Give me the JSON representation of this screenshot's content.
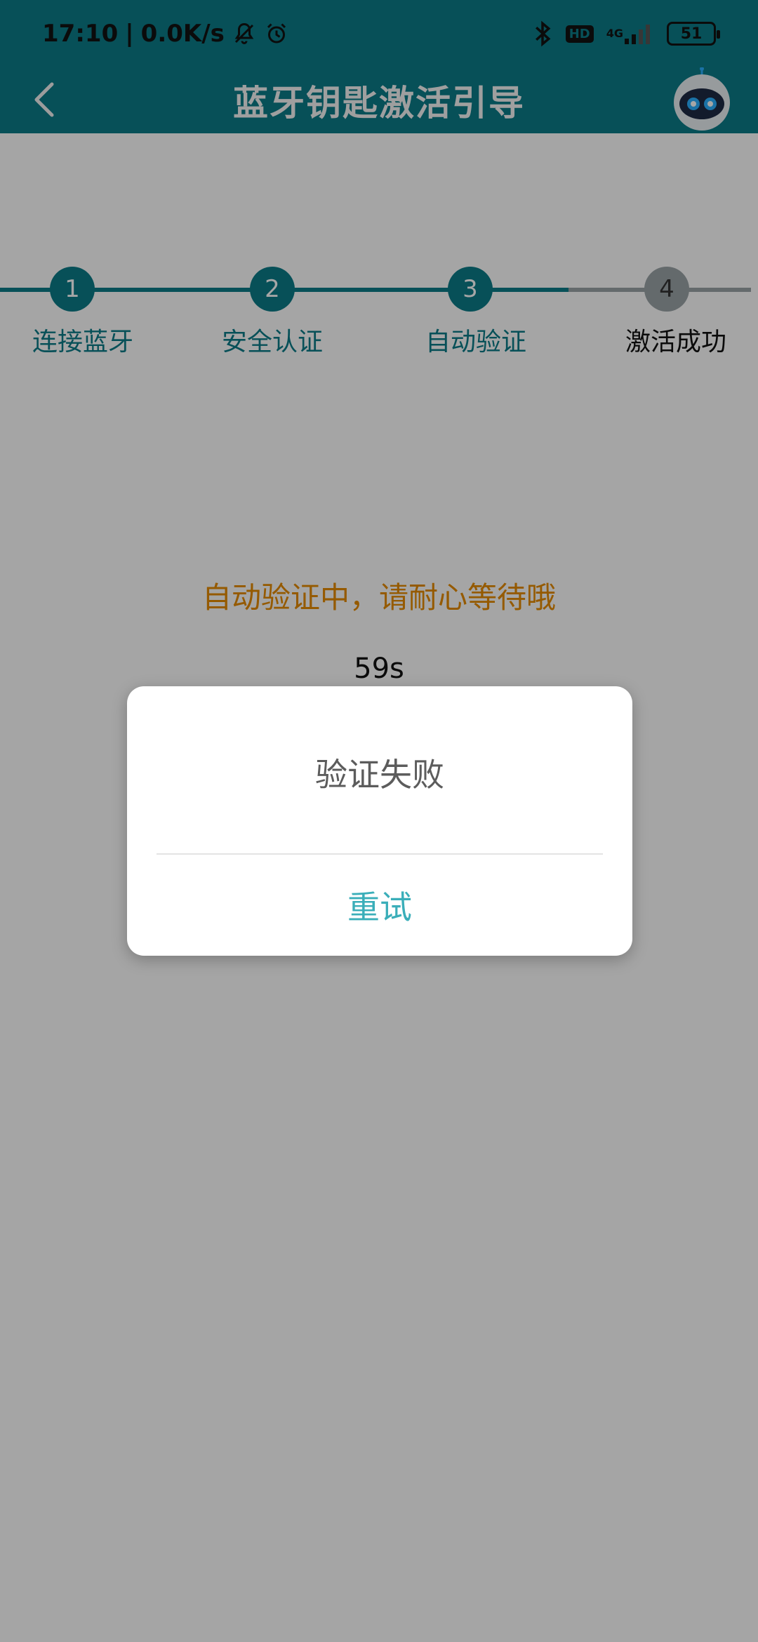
{
  "status_bar": {
    "time": "17:10",
    "net_speed": "0.0K/s",
    "separator": "|",
    "hd": "HD",
    "network": "4G",
    "battery": "51"
  },
  "header": {
    "title": "蓝牙钥匙激活引导"
  },
  "steps": [
    {
      "number": "1",
      "label": "连接蓝牙"
    },
    {
      "number": "2",
      "label": "安全认证"
    },
    {
      "number": "3",
      "label": "自动验证"
    },
    {
      "number": "4",
      "label": "激活成功"
    }
  ],
  "content": {
    "wait_text": "自动验证中，请耐心等待哦",
    "countdown": "59s"
  },
  "dialog": {
    "message": "验证失败",
    "retry_label": "重试"
  },
  "colors": {
    "primary": "#0b7b87",
    "accent_text": "#e58a00",
    "retry": "#3aaeb9",
    "inactive": "#9aa3a7"
  }
}
